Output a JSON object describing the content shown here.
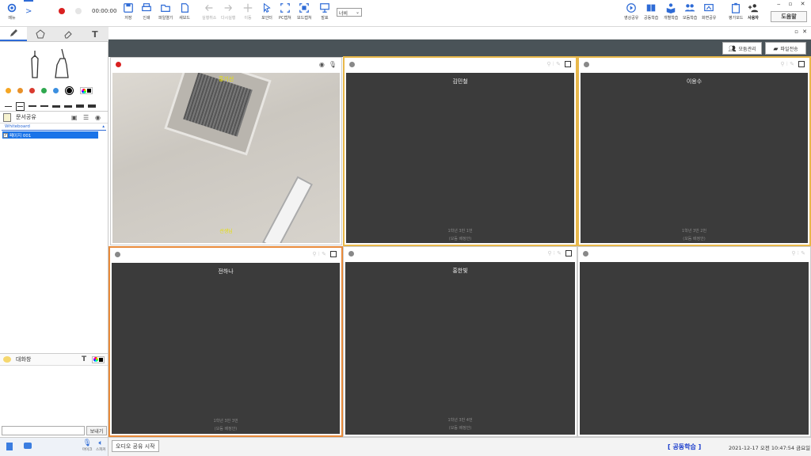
{
  "toolbar": {
    "menu_label": "메뉴",
    "timer": "00:00:00",
    "save": "저장",
    "print": "인쇄",
    "open_file": "파일열기",
    "new_board": "새보드",
    "undo": "실행취소",
    "redo": "다시실행",
    "move": "이동",
    "pointer": "포인터",
    "pc_capture": "PC캡쳐",
    "board_capture": "보드캡쳐",
    "announce": "발표",
    "width_select": "너비",
    "video_share": "영상공유",
    "joint_learning": "공동학습",
    "individual_learning": "개별학습",
    "group_learning": "모둠학습",
    "screen_share": "화면공유",
    "evaluation": "평가모드",
    "users": "사용자",
    "help": "도움말"
  },
  "left": {
    "doc_share_title": "문서공유",
    "whiteboard_label": "Whiteboard",
    "page_item": "페이지 001",
    "chat_title": "대화창",
    "send_label": "보내기",
    "mic_label": "마이크",
    "speaker_label": "스피커",
    "colors": [
      "#f5a623",
      "#e8912a",
      "#d93a2f",
      "#2fa84f",
      "#3b8fe0",
      "#000000"
    ]
  },
  "main": {
    "group_manage": "모둠관리",
    "file_transfer": "파일전송",
    "tiles": [
      {
        "name": "홍기선",
        "footer": "선생님",
        "line1": "",
        "line2": ""
      },
      {
        "name": "김민철",
        "footer": "",
        "line1": "1학년 3반 1번",
        "line2": "(모둠 배정안)"
      },
      {
        "name": "이용수",
        "footer": "",
        "line1": "1학년 3반 2번",
        "line2": "(모둠 배정안)"
      },
      {
        "name": "전하나",
        "footer": "",
        "line1": "1학년 3반 3번",
        "line2": "(모둠 배정안)"
      },
      {
        "name": "홍한빛",
        "footer": "",
        "line1": "1학년 3반 4번",
        "line2": "(모둠 배정안)"
      },
      {
        "name": "",
        "footer": "",
        "line1": "",
        "line2": ""
      }
    ]
  },
  "bottom": {
    "audio_share": "오디오 공유 시작",
    "mode": "[ 공동학습 ]",
    "datetime": "2021-12-17 오전 10:47:54 금요일"
  },
  "colors": {
    "accent": "#2e6bd6",
    "tile_border_yellow": "#e8b84a",
    "tile_border_orange": "#e88a3a"
  }
}
